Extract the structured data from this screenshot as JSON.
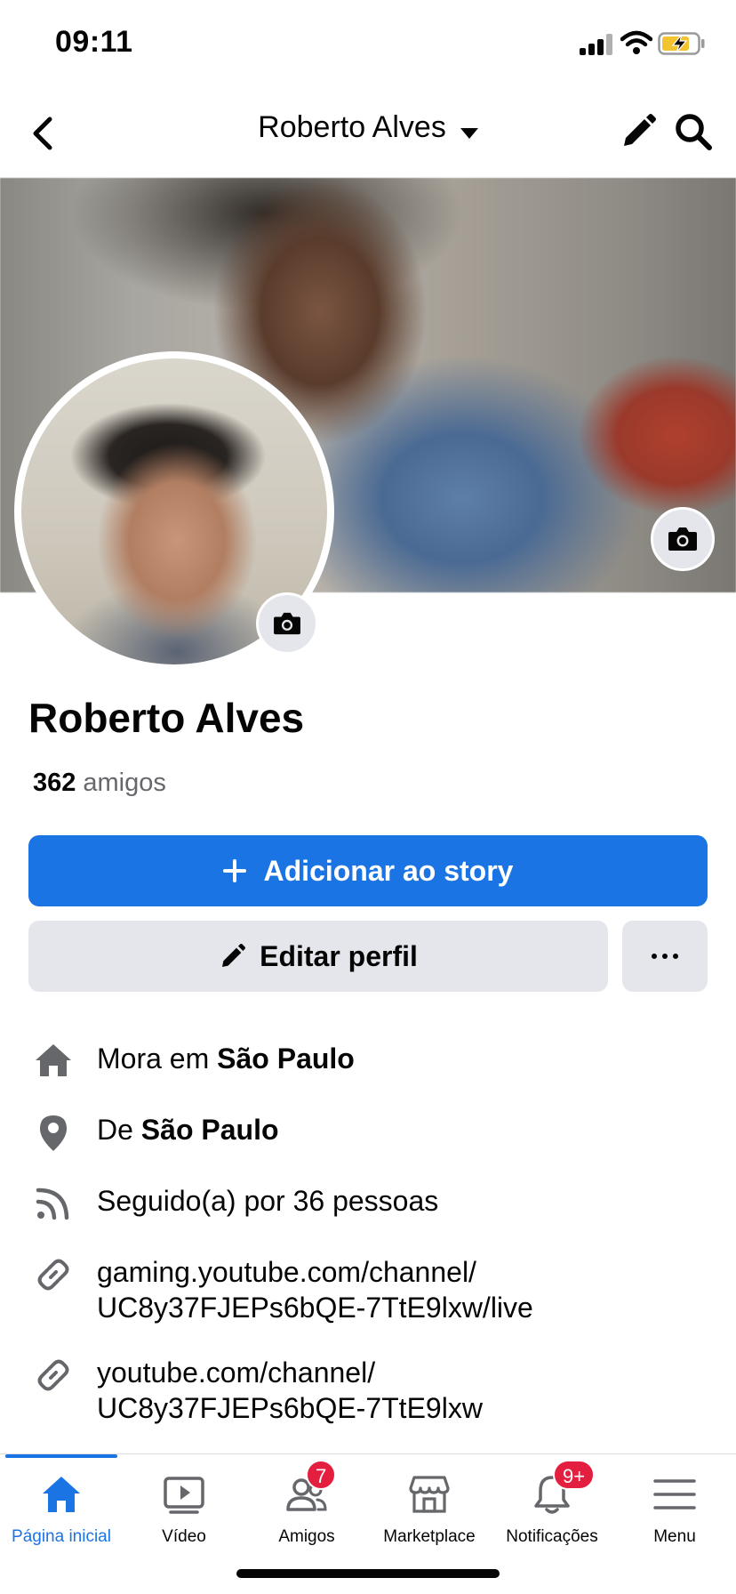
{
  "status_bar": {
    "time": "09:11"
  },
  "header": {
    "title": "Roberto Alves"
  },
  "profile": {
    "name": "Roberto Alves",
    "friends_count": "362",
    "friends_label": "amigos"
  },
  "actions": {
    "add_story_label": "Adicionar ao story",
    "edit_profile_label": "Editar perfil"
  },
  "details": {
    "lives_prefix": "Mora em",
    "lives_city": "São Paulo",
    "from_prefix": "De",
    "from_city": "São Paulo",
    "followers": "Seguido(a) por 36 pessoas",
    "link1_line1": "gaming.youtube.com/channel/",
    "link1_line2": "UC8y37FJEPs6bQE-7TtE9lxw/live",
    "link2_line1": "youtube.com/channel/",
    "link2_line2": "UC8y37FJEPs6bQE-7TtE9lxw"
  },
  "tabs": [
    {
      "label": "Página inicial",
      "icon": "home-icon",
      "active": true
    },
    {
      "label": "Vídeo",
      "icon": "video-icon"
    },
    {
      "label": "Amigos",
      "icon": "friends-icon",
      "badge": "7"
    },
    {
      "label": "Marketplace",
      "icon": "marketplace-icon"
    },
    {
      "label": "Notificações",
      "icon": "bell-icon",
      "badge": "9+"
    },
    {
      "label": "Menu",
      "icon": "menu-icon"
    }
  ],
  "colors": {
    "accent": "#1b74e4",
    "button_gray": "#e4e6eb",
    "badge_red": "#e41e3f",
    "icon_gray": "#65676b"
  }
}
